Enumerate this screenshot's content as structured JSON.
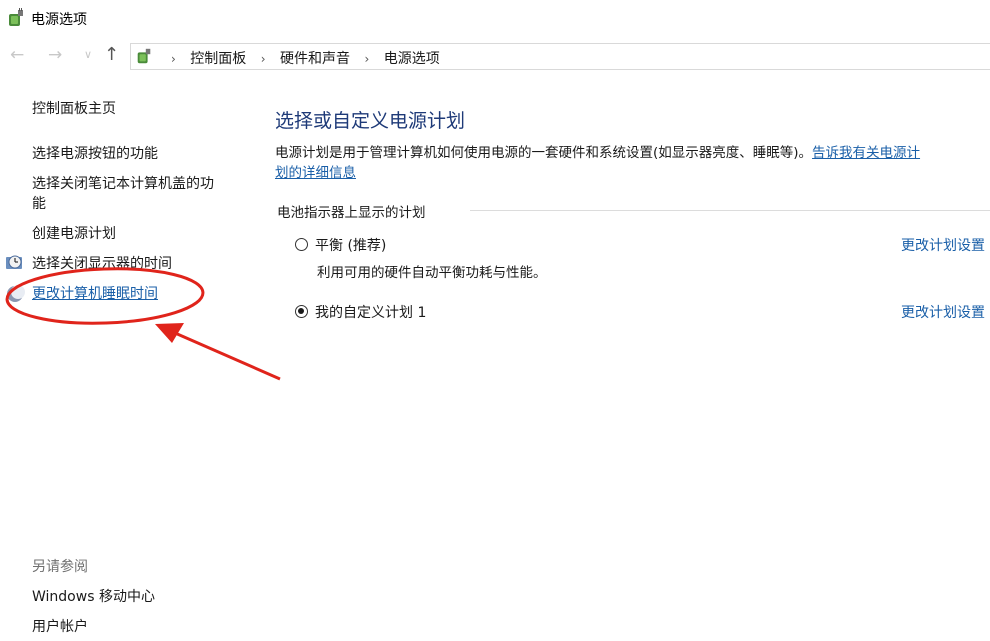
{
  "window": {
    "title": "电源选项",
    "icon": "power-plug-icon"
  },
  "nav": {
    "back_icon": "←",
    "forward_icon": "→",
    "recent_icon": "∨",
    "up_icon": "↑",
    "breadcrumbs": [
      "控制面板",
      "硬件和声音",
      "电源选项"
    ],
    "separator": "›"
  },
  "sidebar": {
    "home": "控制面板主页",
    "items": [
      {
        "label": "选择电源按钮的功能"
      },
      {
        "label": "选择关闭笔记本计算机盖的功"
      },
      {
        "label": "能"
      },
      {
        "label": "创建电源计划"
      },
      {
        "label": "选择关闭显示器的时间"
      },
      {
        "label": "更改计算机睡眠时间"
      }
    ],
    "see_also_title": "另请参阅",
    "see_also": [
      "Windows 移动中心",
      "用户帐户"
    ]
  },
  "main": {
    "title": "选择或自定义电源计划",
    "description": "电源计划是用于管理计算机如何使用电源的一套硬件和系统设置(如显示器亮度、睡眠等)。",
    "description_link_1": "告诉我有关电源计",
    "description_link_2": "划的详细信息",
    "group_label": "电池指示器上显示的计划",
    "plans": [
      {
        "name": "平衡 (推荐)",
        "description": "利用可用的硬件自动平衡功耗与性能。",
        "selected": false,
        "link": "更改计划设置"
      },
      {
        "name": "我的自定义计划 1",
        "description": "",
        "selected": true,
        "link": "更改计划设置"
      }
    ]
  },
  "colors": {
    "link": "#1a5fa8",
    "title": "#1e3a78",
    "annotation": "#e0241b"
  }
}
